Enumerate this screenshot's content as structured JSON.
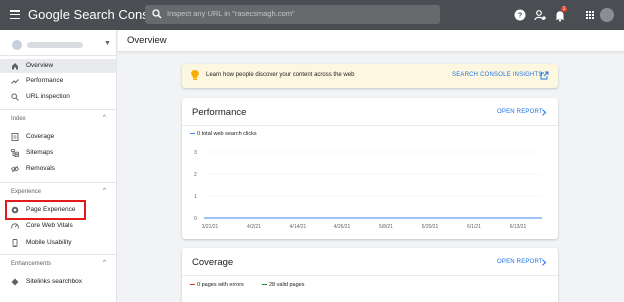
{
  "topbar": {
    "title": "Google Search Console",
    "search_placeholder": "Inspect any URL in \"rasecsmagh.com\"",
    "notification_count": "1"
  },
  "sidebar": {
    "property_name": "",
    "nav": [
      {
        "label": "Overview"
      },
      {
        "label": "Performance"
      },
      {
        "label": "URL inspection"
      }
    ],
    "sections": {
      "index": {
        "label": "Index",
        "items": [
          {
            "label": "Coverage"
          },
          {
            "label": "Sitemaps"
          },
          {
            "label": "Removals"
          }
        ]
      },
      "experience": {
        "label": "Experience",
        "items": [
          {
            "label": "Page Experience"
          },
          {
            "label": "Core Web Vitals"
          },
          {
            "label": "Mobile Usability"
          }
        ]
      },
      "enhancements": {
        "label": "Enhancements",
        "items": [
          {
            "label": "Sitelinks searchbox"
          }
        ]
      }
    }
  },
  "main": {
    "title": "Overview",
    "info": {
      "text": "Learn how people discover your content across the web",
      "link": "SEARCH CONSOLE INSIGHTS"
    },
    "performance": {
      "title": "Performance",
      "link": "OPEN REPORT",
      "legend": "0 total web search clicks"
    },
    "coverage": {
      "title": "Coverage",
      "link": "OPEN REPORT",
      "legend_errors": "0 pages with errors",
      "legend_valid": "28 valid pages"
    }
  },
  "colors": {
    "accent": "#1a73e8",
    "line": "#4285f4",
    "error": "#d93025",
    "valid": "#1e8e3e",
    "highlight": "#e31b1b"
  },
  "chart_data": {
    "type": "line",
    "title": "",
    "xlabel": "",
    "ylabel": "",
    "x": [
      "3/21/21",
      "4/2/21",
      "4/14/21",
      "4/26/21",
      "5/8/21",
      "5/20/21",
      "6/1/21",
      "6/13/21"
    ],
    "yticks": [
      "0",
      "1",
      "2",
      "3"
    ],
    "ylim": [
      0,
      3
    ],
    "grid": true,
    "series": [
      {
        "name": "0 total web search clicks",
        "values": [
          0,
          0,
          0,
          0,
          0,
          0,
          0,
          0
        ],
        "color": "#4285f4"
      }
    ]
  }
}
